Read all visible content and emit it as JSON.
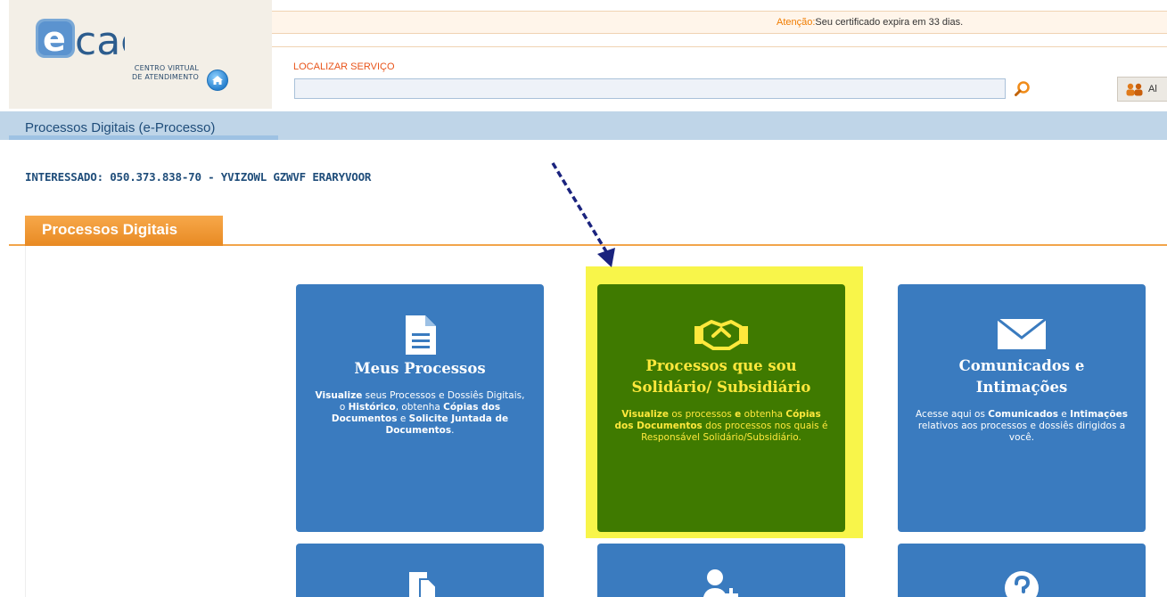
{
  "header": {
    "logo_text": "cac",
    "logo_sub_line1": "CENTRO VIRTUAL",
    "logo_sub_line2": "DE ATENDIMENTO",
    "warning_label": "Atenção:",
    "warning_text": "Seu certificado expira em 33 dias.",
    "search_label": "LOCALIZAR SERVIÇO",
    "search_value": "",
    "side_button_label": "Al"
  },
  "breadcrumb": {
    "label": "Processos Digitais (e-Processo)"
  },
  "interested": {
    "text": "INTERESSADO: 050.373.838-70 - YVIZOWL GZWVF ERARYVOOR"
  },
  "section": {
    "title": "Processos Digitais"
  },
  "tiles": [
    {
      "title_line1": "Meus Processos",
      "desc_bold1": "Visualize",
      "desc_text1": " seus Processos e Dossiês Digitais, o ",
      "desc_bold2": "Histórico",
      "desc_text2": ", obtenha ",
      "desc_bold3": "Cópias dos Documentos",
      "desc_text3": " e ",
      "desc_bold4": "Solicite Juntada de Documentos",
      "desc_text4": "."
    },
    {
      "title_line1": "Processos que sou",
      "title_line2": "Solidário/ Subsidiário",
      "desc_bold1": "Visualize",
      "desc_text1": " os processos ",
      "desc_bold2": "e",
      "desc_text2": " obtenha ",
      "desc_bold3": "Cópias dos Documentos",
      "desc_text3": " dos processos nos quais é Responsável Solidário/Subsidiário."
    },
    {
      "title_line1": "Comunicados e",
      "title_line2": "Intimações",
      "desc_text1": "Acesse aqui os ",
      "desc_bold1": "Comunicados",
      "desc_text2": " e ",
      "desc_bold2": "Intimações",
      "desc_text3": " relativos aos processos e dossiês dirigidos a você."
    }
  ],
  "colors": {
    "tile_blue": "#3a7bbf",
    "tile_green": "#3f7a00",
    "highlight": "#f8f54a",
    "accent_orange": "#e88a23"
  }
}
